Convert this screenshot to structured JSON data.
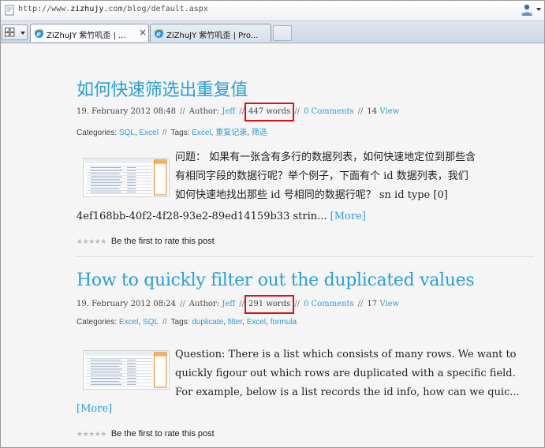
{
  "browser": {
    "url_prefix": "http://www.",
    "url_domain": "zizhujy",
    "url_suffix": ".com/blog/default.aspx",
    "tabs": [
      {
        "label": "ZiZhuJY 紫竹叽歪 | ...",
        "active": true,
        "close": "×"
      },
      {
        "label": "ZiZhuJY 紫竹叽歪 | Pro...",
        "active": false
      }
    ]
  },
  "posts": [
    {
      "title": "如何快速筛选出重复值",
      "date": "19. February 2012 08:48",
      "author_label": "Author:",
      "author": "Jeff",
      "words": "447 words",
      "comments": "0 Comments",
      "views_count": "14",
      "views_label": "View",
      "categories_label": "Categories:",
      "categories": [
        "SQL",
        "Excel"
      ],
      "tags_label": "Tags:",
      "tags": [
        "Excel",
        "重复记录",
        "筛选"
      ],
      "excerpt_lines": [
        "问题： 如果有一张含有多行的数据列表，如何快速地定位到那些含",
        "有相同字段的数据行呢？举个例子，下面有个 id 数据列表，我们",
        "如何快速地找出那些 id 号相同的数据行呢？ sn id type [0]",
        "4ef168bb-40f2-4f28-93e2-89ed14159b33 strin... "
      ],
      "more": "[More]",
      "rating": "Be the first to rate this post"
    },
    {
      "title": "How to quickly filter out the duplicated values",
      "date": "19. February 2012 08:24",
      "author_label": "Author:",
      "author": "Jeff",
      "words": "291 words",
      "comments": "0 Comments",
      "views_count": "17",
      "views_label": "View",
      "categories_label": "Categories:",
      "categories": [
        "Excel",
        "SQL"
      ],
      "tags_label": "Tags:",
      "tags": [
        "duplicate",
        "filter",
        "Excel",
        "formula"
      ],
      "excerpt_lines": [
        "Question: There is a list which consists of many rows. We want to",
        "quickly figour out which rows are duplicated with a specific field.",
        "For example, below is a list records the id info, how can we quic..."
      ],
      "more": "[More]",
      "rating": "Be the first to rate this post"
    }
  ],
  "icons": {
    "favicon": "ie-page-icon",
    "toolbar": "user-profile-icon",
    "tab": "ie-logo-icon"
  },
  "colors": {
    "link": "#2a9fd6",
    "highlight_box": "#e01010"
  }
}
